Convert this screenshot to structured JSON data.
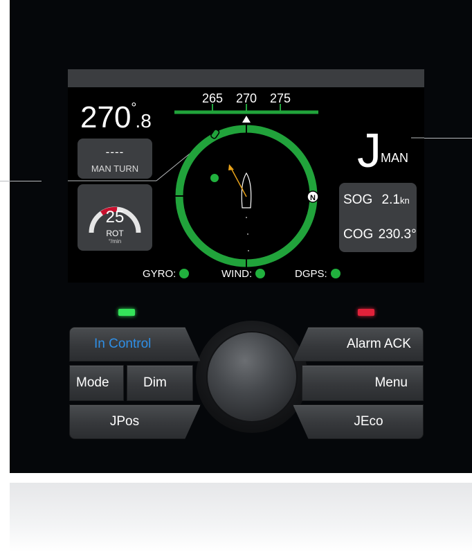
{
  "screen": {
    "heading_int": "270",
    "heading_degree": "°",
    "heading_decimal": ".8",
    "man_turn": {
      "value": "----",
      "label": "MAN TURN"
    },
    "rot": {
      "value": "25",
      "label": "ROT",
      "unit": "°/min"
    },
    "compass": {
      "scale_labels": [
        "265",
        "270",
        "275"
      ],
      "north_marker": "N"
    },
    "mode": {
      "letter": "J",
      "label": "MAN"
    },
    "nav": {
      "sog_label": "SOG",
      "sog_value": "2.1",
      "sog_unit": "kn",
      "cog_label": "COG",
      "cog_value": "230.3°"
    },
    "status": [
      {
        "label": "GYRO:",
        "color": "#21b13e"
      },
      {
        "label": "WIND:",
        "color": "#21b13e"
      },
      {
        "label": "DGPS:",
        "color": "#21b13e"
      }
    ]
  },
  "leds": {
    "left_color": "#35e35a",
    "right_color": "#e0223a"
  },
  "buttons": {
    "in_control": "In Control",
    "mode": "Mode",
    "dim": "Dim",
    "jpos": "JPos",
    "alarm_ack": "Alarm ACK",
    "menu": "Menu",
    "jeco": "JEco"
  },
  "colors": {
    "in_control_text": "#2f8fe6",
    "gauge_green": "#21a33b",
    "rot_red": "#c8102e"
  }
}
